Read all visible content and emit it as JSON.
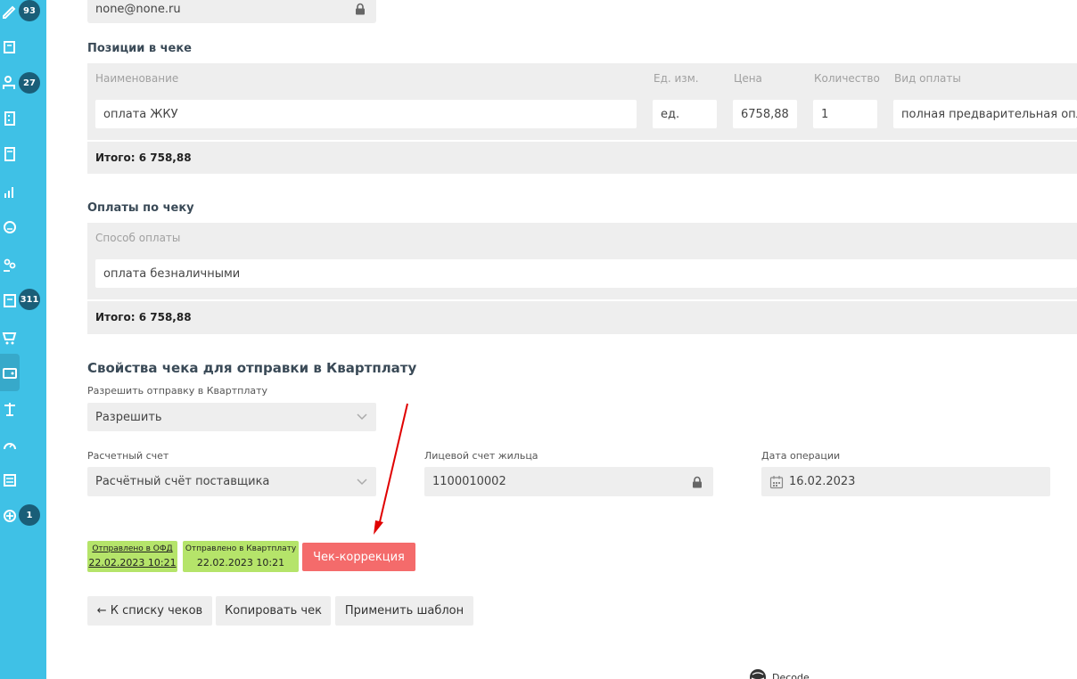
{
  "sidebar": {
    "badges": [
      "93",
      "27",
      "311",
      "1"
    ]
  },
  "contact": {
    "email": "none@none.ru"
  },
  "positions": {
    "title": "Позиции в чеке",
    "headers": [
      "Наименование",
      "Ед. изм.",
      "Цена",
      "Количество",
      "Вид оплаты"
    ],
    "row": [
      "оплата ЖКУ",
      "ед.",
      "6758,88",
      "1",
      "полная предварительная опл"
    ],
    "total": "Итого: 6 758,88"
  },
  "payments": {
    "title": "Оплаты по чеку",
    "header": "Способ оплаты",
    "row": "оплата безналичными",
    "total": "Итого: 6 758,88"
  },
  "props": {
    "title": "Свойства чека для отправки в Квартплату",
    "allow_label": "Разрешить отправку в Квартплату",
    "allow_value": "Разрешить",
    "account_label": "Расчетный счет",
    "account_value": "Расчётный счёт поставщика",
    "resident_label": "Лицевой счет жильца",
    "resident_value": "1100010002",
    "date_label": "Дата операции",
    "date_value": "16.02.2023"
  },
  "status": {
    "ofd_label": "Отправлено в ОФД",
    "ofd_time": "22.02.2023 10:21",
    "kp_label": "Отправлено в Квартплату",
    "kp_time": "22.02.2023 10:21",
    "correction": "Чек-коррекция"
  },
  "actions": {
    "back": "← К списку чеков",
    "copy": "Копировать чек",
    "template": "Применить шаблон"
  },
  "colors": {
    "sidebar": "#3fc1e6",
    "badge": "#1a5e78",
    "tag": "#b5e46a",
    "correction": "#f46b6b",
    "annotation_arrow": "#e00000"
  },
  "footer": {
    "logo_text": "Decode"
  }
}
